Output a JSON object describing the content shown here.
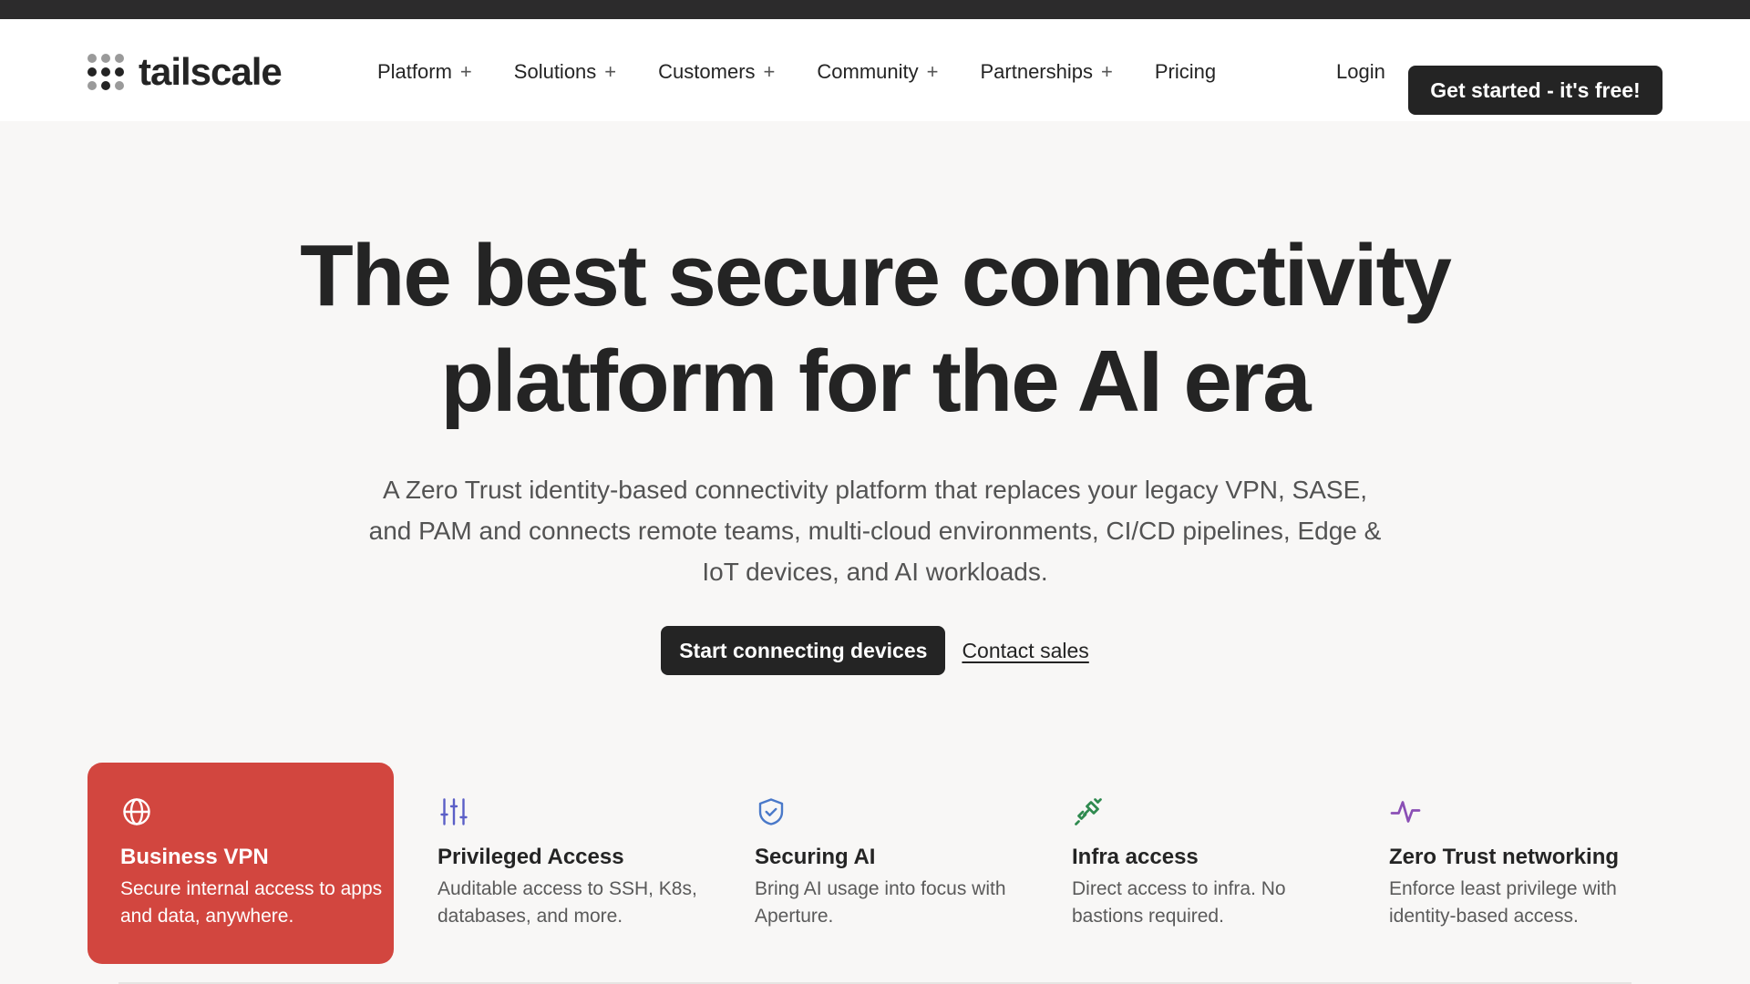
{
  "nav": {
    "logo_text": "tailscale",
    "items": [
      {
        "label": "Platform",
        "plus": "+"
      },
      {
        "label": "Solutions",
        "plus": "+"
      },
      {
        "label": "Customers",
        "plus": "+"
      },
      {
        "label": "Community",
        "plus": "+"
      },
      {
        "label": "Partnerships",
        "plus": "+"
      },
      {
        "label": "Pricing"
      }
    ],
    "login": "Login",
    "cta": "Get started - it's free!"
  },
  "hero": {
    "title_line1": "The best secure connectivity",
    "title_line2": "platform for the AI era",
    "subtitle": "A Zero Trust identity-based connectivity platform that replaces your legacy VPN, SASE, and PAM and connects remote teams, multi-cloud environments, CI/CD pipelines, Edge & IoT devices, and AI workloads.",
    "primary_cta": "Start connecting devices",
    "secondary_cta": "Contact sales"
  },
  "features": [
    {
      "icon": "globe-icon",
      "title": "Business VPN",
      "desc": "Secure internal access to apps and data, anywhere.",
      "active": true,
      "color": "#d2463f"
    },
    {
      "icon": "sliders-icon",
      "title": "Privileged Access",
      "desc": "Auditable access to SSH, K8s, databases, and more.",
      "color": "#5b5fc7"
    },
    {
      "icon": "shield-check-icon",
      "title": "Securing AI",
      "desc": "Bring AI usage into focus with Aperture.",
      "color": "#4a79c9"
    },
    {
      "icon": "plug-icon",
      "title": "Infra access",
      "desc": "Direct access to infra. No bastions required.",
      "color": "#2f8a4f"
    },
    {
      "icon": "activity-icon",
      "title": "Zero Trust networking",
      "desc": "Enforce least privilege with identity-based access.",
      "color": "#8a4fb5"
    }
  ]
}
